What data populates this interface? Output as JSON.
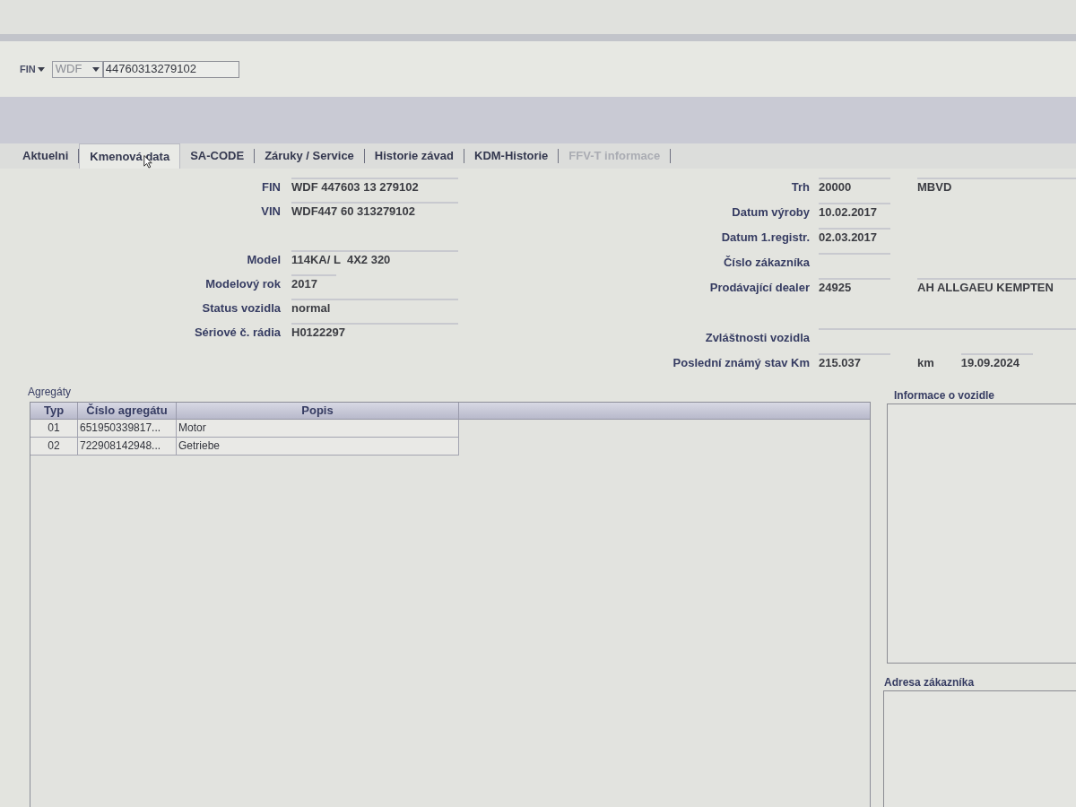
{
  "search": {
    "mode": "FIN",
    "prefix": "WDF",
    "value": "44760313279102"
  },
  "tabs": [
    {
      "label": "Aktuelni",
      "selected": false,
      "disabled": false
    },
    {
      "label": "Kmenová data",
      "selected": true,
      "disabled": false
    },
    {
      "label": "SA-CODE",
      "selected": false,
      "disabled": false
    },
    {
      "label": "Záruky / Service",
      "selected": false,
      "disabled": false
    },
    {
      "label": "Historie závad",
      "selected": false,
      "disabled": false
    },
    {
      "label": "KDM-Historie",
      "selected": false,
      "disabled": false
    },
    {
      "label": "FFV-T informace",
      "selected": false,
      "disabled": true
    }
  ],
  "form_left": [
    [
      {
        "label": "FIN",
        "parts": [
          {
            "kind": "field",
            "value": "WDF 447603 13 279102"
          }
        ]
      },
      {
        "label": "VIN",
        "parts": [
          {
            "kind": "field",
            "value": "WDF447 60 313279102"
          }
        ]
      }
    ],
    [
      {
        "label": "Model",
        "parts": [
          {
            "kind": "field",
            "value": "114KA/ L  4X2 320"
          }
        ]
      },
      {
        "label": "Modelový rok",
        "parts": [
          {
            "kind": "short_field",
            "value": "2017"
          }
        ]
      },
      {
        "label": "Status vozidla",
        "parts": [
          {
            "kind": "field",
            "value": "normal"
          }
        ]
      },
      {
        "label": "Sériové č. rádia",
        "parts": [
          {
            "kind": "field",
            "value": "H0122297"
          }
        ]
      }
    ]
  ],
  "form_right": [
    [
      {
        "label": "Trh",
        "parts": [
          {
            "kind": "field",
            "value": "20000"
          },
          {
            "kind": "wide_field",
            "value": "MBVD"
          }
        ]
      },
      {
        "label": "Datum výroby",
        "parts": [
          {
            "kind": "field",
            "value": "10.02.2017"
          }
        ]
      },
      {
        "label": "Datum 1.registr.",
        "parts": [
          {
            "kind": "field",
            "value": "02.03.2017"
          }
        ]
      },
      {
        "label": "Číslo zákazníka",
        "parts": [
          {
            "kind": "field"
          }
        ]
      },
      {
        "label": "Prodávající dealer",
        "parts": [
          {
            "kind": "field",
            "value": "24925"
          },
          {
            "kind": "wide_field",
            "value": "AH ALLGAEU KEMPTEN"
          }
        ]
      }
    ],
    [
      {
        "label": "Zvláštnosti vozidla",
        "parts": [
          {
            "kind": "wide_field"
          }
        ]
      },
      {
        "label": "Poslední známý stav Km",
        "parts": [
          {
            "kind": "field",
            "value": "215.037"
          },
          {
            "kind": "text",
            "value": "km"
          },
          {
            "kind": "field",
            "value": "19.09.2024"
          }
        ]
      }
    ]
  ],
  "aggregates": {
    "title": "Agregáty",
    "columns": [
      "Typ",
      "Číslo agregátu",
      "Popis"
    ],
    "rows": [
      [
        "01",
        "651950339817...",
        "Motor"
      ],
      [
        "02",
        "722908142948...",
        "Getriebe"
      ]
    ]
  },
  "vehicle_info": {
    "title": "Informace o vozidle"
  },
  "customer_address": {
    "title": "Adresa zákazníka"
  }
}
